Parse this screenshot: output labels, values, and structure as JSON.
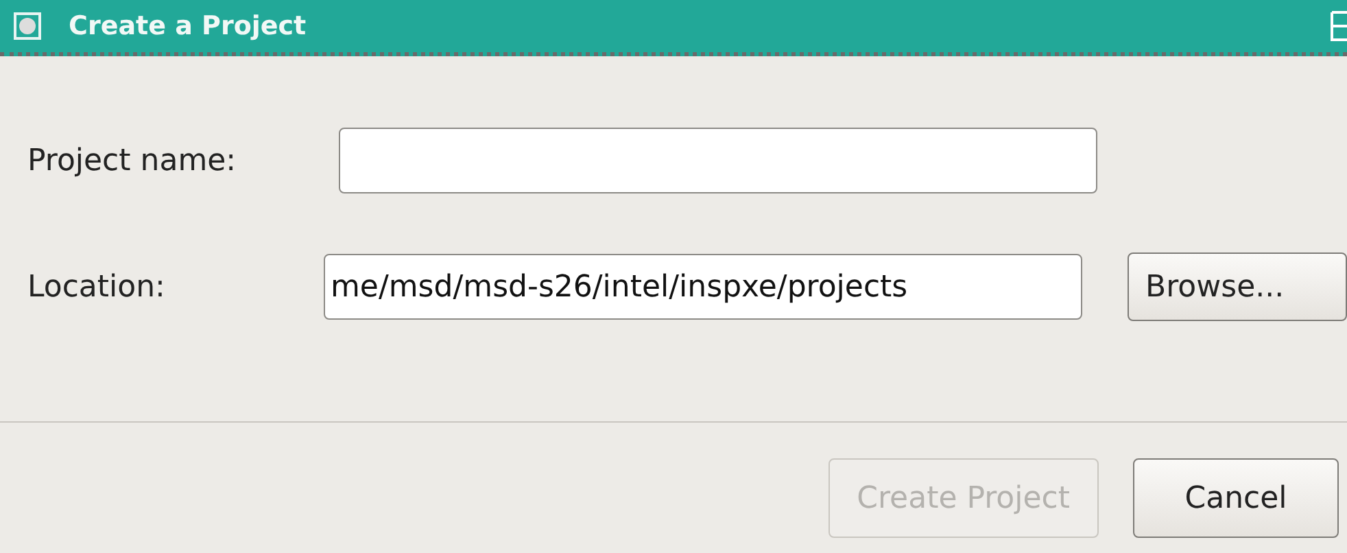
{
  "window": {
    "title": "Create a Project"
  },
  "fields": [
    {
      "label": "Project name:"
    },
    {
      "label": "Location:",
      "value": "me/msd/msd-s26/intel/inspxe/projects",
      "button": "Browse..."
    }
  ],
  "buttons": [
    {
      "label": "Create Project",
      "disabled": true
    },
    {
      "label": "Cancel",
      "disabled": false
    }
  ]
}
